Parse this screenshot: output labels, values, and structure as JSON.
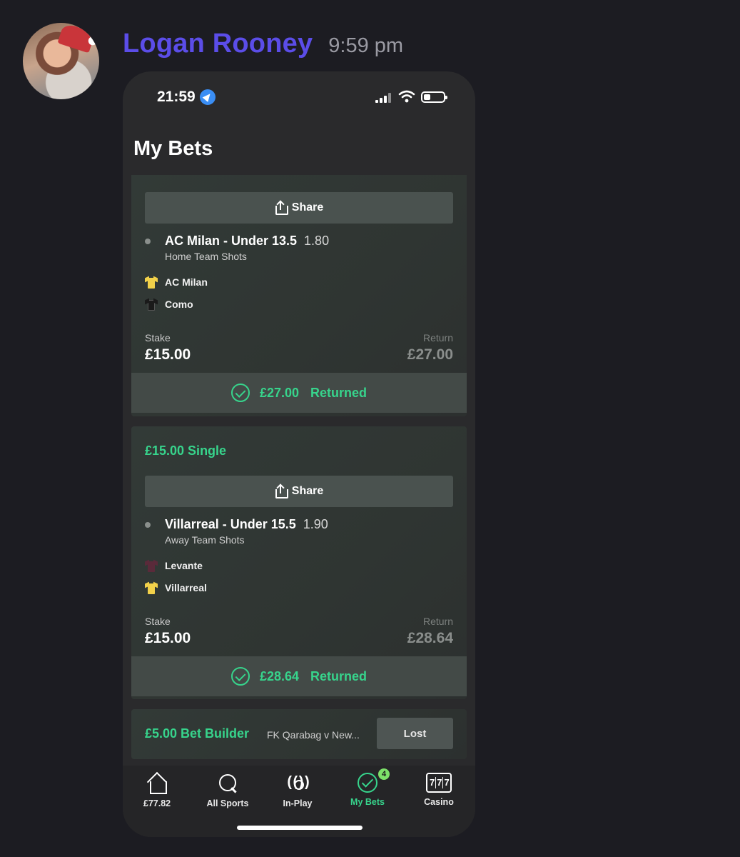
{
  "message": {
    "username": "Logan Rooney",
    "time": "9:59 pm"
  },
  "phone": {
    "status_time": "21:59",
    "page_title": "My Bets"
  },
  "bets": [
    {
      "share_label": "Share",
      "selection": "AC Milan - Under 13.5",
      "odds": "1.80",
      "market": "Home Team Shots",
      "teams": [
        {
          "name": "AC Milan",
          "shirt_color": "#f2d14a"
        },
        {
          "name": "Como",
          "shirt_color": "#1a1a1a"
        }
      ],
      "stake_label": "Stake",
      "stake": "£15.00",
      "return_label": "Return",
      "return": "£27.00",
      "returned_amount": "£27.00",
      "returned_label": "Returned"
    },
    {
      "header": "£15.00 Single",
      "share_label": "Share",
      "selection": "Villarreal - Under 15.5",
      "odds": "1.90",
      "market": "Away Team Shots",
      "teams": [
        {
          "name": "Levante",
          "shirt_color": "#5a2a3a"
        },
        {
          "name": "Villarreal",
          "shirt_color": "#f2d14a"
        }
      ],
      "stake_label": "Stake",
      "stake": "£15.00",
      "return_label": "Return",
      "return": "£28.64",
      "returned_amount": "£28.64",
      "returned_label": "Returned"
    },
    {
      "header": "£5.00 Bet Builder",
      "event": "FK Qarabag v New...",
      "status": "Lost"
    }
  ],
  "tabbar": {
    "tabs": [
      {
        "label": "£77.82",
        "icon": "home-icon"
      },
      {
        "label": "All Sports",
        "icon": "search-icon"
      },
      {
        "label": "In-Play",
        "icon": "broadcast-icon"
      },
      {
        "label": "My Bets",
        "icon": "check-circle-icon",
        "active": true,
        "badge": "4"
      },
      {
        "label": "Casino",
        "icon": "slot-machine-icon",
        "glyph": "777"
      }
    ]
  },
  "colors": {
    "accent_green": "#37d48c",
    "username": "#5b4de8",
    "background": "#1c1c22"
  }
}
